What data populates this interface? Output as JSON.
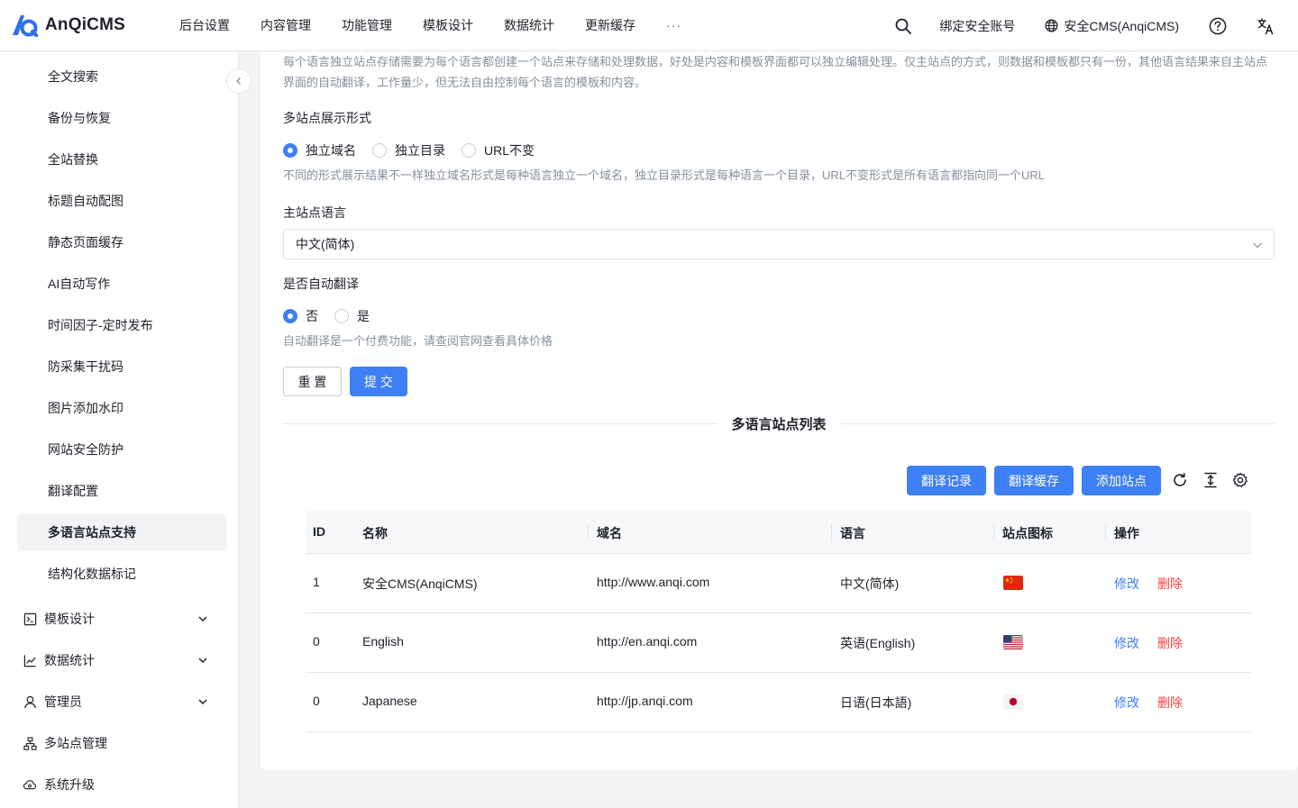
{
  "app": {
    "name": "AnQiCMS"
  },
  "topnav": [
    "后台设置",
    "内容管理",
    "功能管理",
    "模板设计",
    "数据统计",
    "更新缓存"
  ],
  "topnav_more": "···",
  "topright": {
    "bind_account": "绑定安全账号",
    "site_name": "安全CMS(AnqiCMS)"
  },
  "sidebar": {
    "items": [
      "全文搜索",
      "备份与恢复",
      "全站替换",
      "标题自动配图",
      "静态页面缓存",
      "AI自动写作",
      "时间因子-定时发布",
      "防采集干扰码",
      "图片添加水印",
      "网站安全防护",
      "翻译配置",
      "多语言站点支持",
      "结构化数据标记"
    ],
    "active": "多语言站点支持",
    "groups": [
      "模板设计",
      "数据统计",
      "管理员",
      "多站点管理",
      "系统升级"
    ]
  },
  "form": {
    "intro": "每个语言独立站点存储需要为每个语言都创建一个站点来存储和处理数据，好处是内容和模板界面都可以独立编辑处理。仅主站点的方式，则数据和模板都只有一份，其他语言结果来自主站点界面的自动翻译，工作量少，但无法自由控制每个语言的模板和内容。",
    "display_label": "多站点展示形式",
    "display_options": [
      "独立域名",
      "独立目录",
      "URL不变"
    ],
    "display_selected": "独立域名",
    "display_help": "不同的形式展示结果不一样独立域名形式是每种语言独立一个域名，独立目录形式是每种语言一个目录，URL不变形式是所有语言都指向同一个URL",
    "lang_label": "主站点语言",
    "lang_value": "中文(简体)",
    "auto_label": "是否自动翻译",
    "auto_options": [
      "否",
      "是"
    ],
    "auto_selected": "否",
    "auto_help": "自动翻译是一个付费功能，请查阅官网查看具体价格",
    "reset_label": "重 置",
    "submit_label": "提 交"
  },
  "list": {
    "title": "多语言站点列表",
    "buttons": [
      "翻译记录",
      "翻译缓存",
      "添加站点"
    ],
    "columns": [
      "ID",
      "名称",
      "域名",
      "语言",
      "站点图标",
      "操作"
    ],
    "rows": [
      {
        "id": "1",
        "name": "安全CMS(AnqiCMS)",
        "domain": "http://www.anqi.com",
        "lang": "中文(简体)",
        "flag": "cn"
      },
      {
        "id": "0",
        "name": "English",
        "domain": "http://en.anqi.com",
        "lang": "英语(English)",
        "flag": "us"
      },
      {
        "id": "0",
        "name": "Japanese",
        "domain": "http://jp.anqi.com",
        "lang": "日语(日本語)",
        "flag": "jp"
      }
    ],
    "edit_label": "修改",
    "delete_label": "删除"
  },
  "colors": {
    "primary": "#3d7ff5",
    "danger": "#f53f3f"
  }
}
